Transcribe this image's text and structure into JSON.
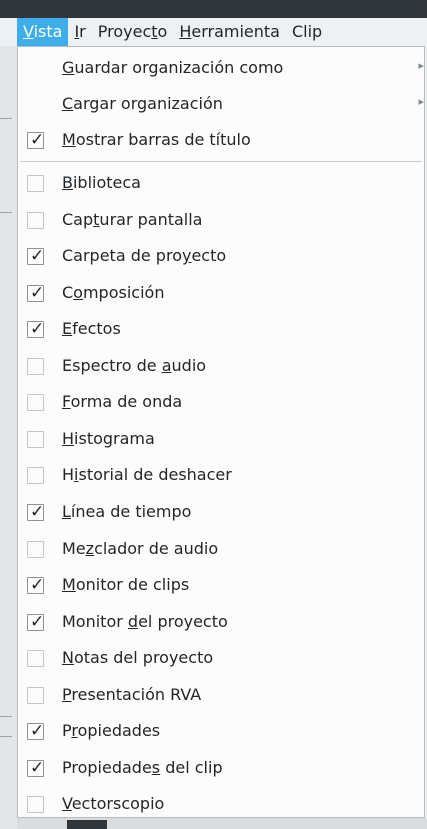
{
  "menubar": [
    {
      "pre": "",
      "u": "V",
      "post": "ista",
      "active": true
    },
    {
      "pre": "",
      "u": "I",
      "post": "r",
      "active": false
    },
    {
      "pre": "Proyec",
      "u": "t",
      "post": "o",
      "active": false
    },
    {
      "pre": "",
      "u": "H",
      "post": "erramienta",
      "active": false
    },
    {
      "pre": "Clip",
      "u": "",
      "post": "",
      "active": false
    }
  ],
  "menu": {
    "submenus": [
      {
        "pre": "",
        "u": "G",
        "post": "uardar organización como",
        "arrow": "▸"
      },
      {
        "pre": "",
        "u": "C",
        "post": "argar organización",
        "arrow": "▸"
      }
    ],
    "show_titlebars": {
      "pre": "",
      "u": "M",
      "post": "ostrar barras de título",
      "checked": true
    },
    "checkmark": "✓",
    "items": [
      {
        "pre": "",
        "u": "B",
        "post": "iblioteca",
        "checked": false
      },
      {
        "pre": "Cap",
        "u": "t",
        "post": "urar pantalla",
        "checked": false
      },
      {
        "pre": "Carpeta de pro",
        "u": "y",
        "post": "ecto",
        "checked": true
      },
      {
        "pre": "C",
        "u": "o",
        "post": "mposición",
        "checked": true
      },
      {
        "pre": "",
        "u": "E",
        "post": "fectos",
        "checked": true
      },
      {
        "pre": "Espectro de ",
        "u": "a",
        "post": "udio",
        "checked": false
      },
      {
        "pre": "",
        "u": "F",
        "post": "orma de onda",
        "checked": false
      },
      {
        "pre": "",
        "u": "H",
        "post": "istograma",
        "checked": false
      },
      {
        "pre": "H",
        "u": "i",
        "post": "storial de deshacer",
        "checked": false
      },
      {
        "pre": "",
        "u": "L",
        "post": "ínea de tiempo",
        "checked": true
      },
      {
        "pre": "Me",
        "u": "z",
        "post": "clador de audio",
        "checked": false
      },
      {
        "pre": "",
        "u": "M",
        "post": "onitor de clips",
        "checked": true
      },
      {
        "pre": "Monitor ",
        "u": "d",
        "post": "el proyecto",
        "checked": true
      },
      {
        "pre": "",
        "u": "N",
        "post": "otas del proyecto",
        "checked": false
      },
      {
        "pre": "",
        "u": "P",
        "post": "resentación RVA",
        "checked": false
      },
      {
        "pre": "P",
        "u": "r",
        "post": "opiedades",
        "checked": true
      },
      {
        "pre": "Propiedade",
        "u": "s",
        "post": " del clip",
        "checked": true
      },
      {
        "pre": "",
        "u": "V",
        "post": "ectorscopio",
        "checked": false
      }
    ]
  },
  "colors": {
    "accent": "#3daee9",
    "menu_bg": "#fcfcfc"
  }
}
